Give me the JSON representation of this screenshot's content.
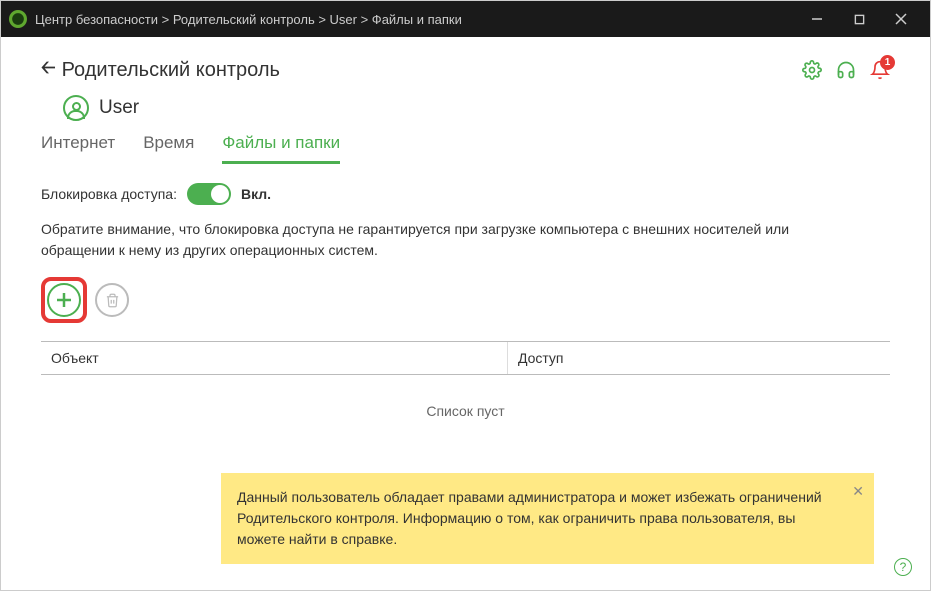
{
  "titlebar": {
    "breadcrumb": "Центр безопасности > Родительский контроль > User > Файлы и папки"
  },
  "header": {
    "back_title": "Родительский контроль",
    "bell_count": "1"
  },
  "user": {
    "name": "User"
  },
  "tabs": {
    "internet": "Интернет",
    "time": "Время",
    "files": "Файлы и папки"
  },
  "block": {
    "label": "Блокировка доступа:",
    "state": "Вкл."
  },
  "note": "Обратите внимание, что блокировка доступа не гарантируется при загрузке компьютера с внешних носителей или обращении к нему из других операционных систем.",
  "table": {
    "col_object": "Объект",
    "col_access": "Доступ",
    "empty": "Список пуст"
  },
  "warning": "Данный пользователь обладает правами администратора и может избежать ограничений Родительского контроля. Информацию о том, как ограничить права пользователя, вы можете найти в справке."
}
